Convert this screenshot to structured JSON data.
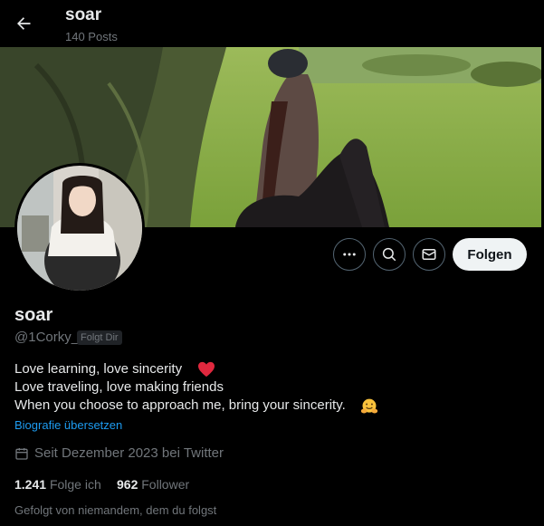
{
  "header": {
    "title": "soar",
    "post_count": "140 Posts"
  },
  "profile": {
    "name": "soar",
    "handle": "@1Corky_",
    "follows_you_badge": "Folgt Dir",
    "follow_button_label": "Folgen",
    "bio_lines": [
      "Love learning, love sincerity",
      "Love traveling, love making friends",
      "When you choose to approach me, bring your sincerity."
    ],
    "translate_link": "Biografie übersetzen",
    "joined": "Seit Dezember 2023 bei Twitter",
    "following_count": "1.241",
    "following_label": "Folge ich",
    "followers_count": "962",
    "followers_label": "Follower",
    "followed_by_note": "Gefolgt von niemandem, dem du folgst"
  },
  "icons": {
    "back": "arrow-left-icon",
    "more": "more-dots-icon",
    "search": "search-icon",
    "message": "envelope-icon",
    "calendar": "calendar-icon",
    "heart": "red-heart-emoji",
    "hug": "hugging-face-emoji"
  },
  "colors": {
    "background": "#000000",
    "text": "#e7e9ea",
    "muted": "#71767b",
    "link": "#1d9bf0",
    "follow_button_bg": "#eff3f4"
  }
}
